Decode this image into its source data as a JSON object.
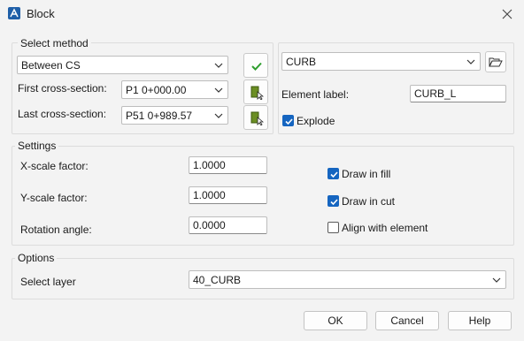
{
  "window": {
    "title": "Block",
    "app_icon": "autocad-icon",
    "close_icon": "close-icon"
  },
  "select_method": {
    "group_title": "Select method",
    "method_value": "Between CS",
    "first_cs_label": "First cross-section:",
    "first_cs_value": "P1 0+000.00",
    "last_cs_label": "Last cross-section:",
    "last_cs_value": "P51 0+989.57",
    "confirm_icon": "checkmark-icon",
    "pick_icon": "pick-section-icon"
  },
  "element": {
    "element_value": "CURB",
    "browse_icon": "folder-open-icon",
    "label_caption": "Element label:",
    "label_value": "CURB_L",
    "explode_label": "Explode",
    "explode_checked": true
  },
  "settings": {
    "group_title": "Settings",
    "x_scale_label": "X-scale factor:",
    "x_scale_value": "1.0000",
    "y_scale_label": "Y-scale factor:",
    "y_scale_value": "1.0000",
    "rotation_label": "Rotation angle:",
    "rotation_value": "0.0000",
    "draw_in_fill_label": "Draw in fill",
    "draw_in_fill_checked": true,
    "draw_in_cut_label": "Draw in cut",
    "draw_in_cut_checked": true,
    "align_label": "Align with element",
    "align_checked": false
  },
  "options": {
    "group_title": "Options",
    "layer_label": "Select layer",
    "layer_value": "40_CURB"
  },
  "footer": {
    "ok_label": "OK",
    "cancel_label": "Cancel",
    "help_label": "Help"
  },
  "colors": {
    "accent": "#1565c0",
    "confirm_green": "#2e9e2e",
    "background": "#f3f3f3"
  }
}
